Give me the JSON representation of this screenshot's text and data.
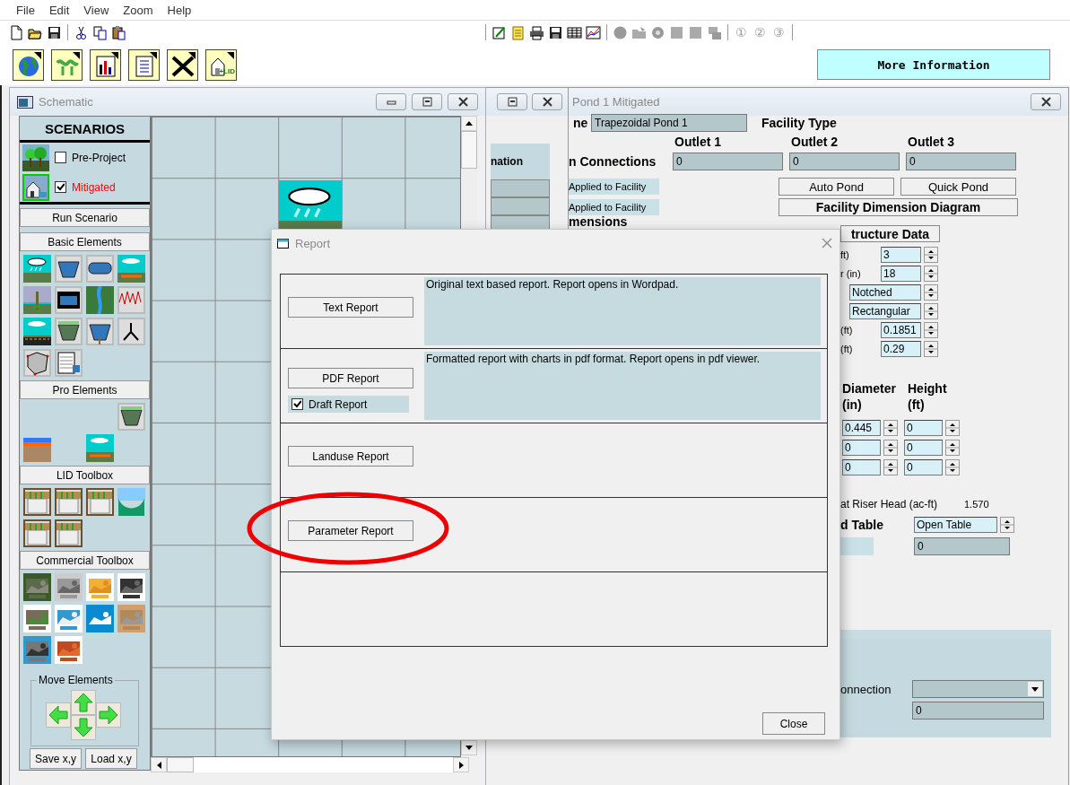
{
  "menu_bar": [
    "File",
    "Edit",
    "View",
    "Zoom",
    "Help"
  ],
  "toolbar": {
    "numbers": [
      "①",
      "②",
      "③"
    ]
  },
  "big_toolbar": {
    "lid_label": "+LID"
  },
  "more_information_button": "More Information",
  "facility_window": {
    "title": "Pond 1 Mitigated",
    "name_label": "ne",
    "name_value": "Trapezoidal Pond 1",
    "facility_type_label": "Facility Type",
    "outlet_headers": [
      "Outlet 1",
      "Outlet 2",
      "Outlet 3"
    ],
    "connections_label": "n Connections",
    "connections": [
      "0",
      "0",
      "0"
    ],
    "applied_labels": [
      "Applied to Facility",
      "Applied to Facility"
    ],
    "buttons": [
      "Auto Pond",
      "Quick Pond"
    ],
    "diagram_button": "Facility Dimension Diagram",
    "dimensions_label": "mensions",
    "structure_button": "tructure Data",
    "structure_fields": [
      {
        "label": "ft)",
        "value": "3"
      },
      {
        "label": "r (in)",
        "value": "18"
      },
      {
        "value": "Notched"
      },
      {
        "value": "Rectangular"
      },
      {
        "label": "(ft)",
        "value": "0.1851"
      },
      {
        "label": "(ft)",
        "value": "0.29"
      }
    ],
    "orifice": {
      "headers": [
        "Diameter",
        "Height"
      ],
      "units": [
        "(in)",
        "(ft)"
      ],
      "rows": [
        [
          "0.445",
          "0"
        ],
        [
          "0",
          "0"
        ],
        [
          "0",
          "0"
        ]
      ]
    },
    "riser_head": {
      "label": "at Riser Head (ac-ft)",
      "value": "1.570"
    },
    "table_label": "d Table",
    "table_select": "Open Table",
    "table_value": "0",
    "connection": {
      "label": "onnection",
      "value": "0"
    }
  },
  "side_window": {
    "column_header": "nation"
  },
  "schematic_window": {
    "title": "Schematic",
    "scenarios": {
      "title": "SCENARIOS",
      "items": [
        {
          "label": "Pre-Project",
          "checked": false,
          "selected": false
        },
        {
          "label": "Mitigated",
          "checked": true,
          "selected": true
        }
      ]
    },
    "run_button": "Run Scenario",
    "sections": [
      "Basic Elements",
      "Pro Elements",
      "LID Toolbox",
      "Commercial Toolbox"
    ],
    "move_elements": "Move Elements",
    "buttons": [
      "Save x,y",
      "Load x,y"
    ]
  },
  "report_dialog": {
    "title": "Report",
    "reports": [
      {
        "button": "Text Report",
        "description": "Original text based report. Report opens in Wordpad."
      },
      {
        "button": "PDF Report",
        "description": "Formatted report with charts in pdf format. Report opens in pdf viewer.",
        "option": {
          "label": "Draft Report",
          "checked": true
        }
      },
      {
        "button": "Landuse Report"
      },
      {
        "button": "Parameter Report"
      }
    ],
    "close_button": "Close"
  }
}
